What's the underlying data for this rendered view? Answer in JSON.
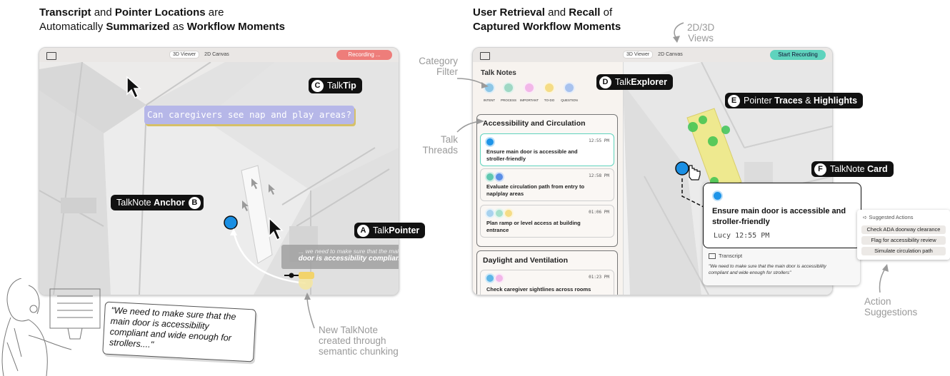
{
  "left_heading": {
    "p1": "Transcript",
    "p2": " and ",
    "p3": "Pointer Locations",
    "p4": " are",
    "p5": "Automatically ",
    "p6": "Summarized",
    "p7": " as ",
    "p8": "Workflow Moments"
  },
  "right_heading": {
    "p1": "User Retrieval",
    "p2": " and ",
    "p3": "Recall",
    "p4": " of",
    "p5": "Captured Workflow Moments"
  },
  "left_app": {
    "tab_3d": "3D Viewer",
    "tab_2d": "2D Canvas",
    "record_label": "Recording ...",
    "talktip_text": "Can caregivers see nap and play areas?",
    "transcript_line1": "... we need to make sure that the main",
    "transcript_line2": "door is accessibility compliant"
  },
  "labels": {
    "A": {
      "letter": "A",
      "pre": "Talk",
      "bold": "Pointer"
    },
    "B": {
      "letter": "B",
      "pre": "TalkNote ",
      "bold": "Anchor"
    },
    "C": {
      "letter": "C",
      "pre": "Talk",
      "bold": "Tip"
    },
    "D": {
      "letter": "D",
      "pre": "Talk",
      "bold": "Explorer"
    },
    "E": {
      "letter": "E",
      "pre": "Pointer ",
      "bold": "Traces",
      "mid": " & ",
      "bold2": "Highlights"
    },
    "F": {
      "letter": "F",
      "pre": "TalkNote ",
      "bold": "Card"
    }
  },
  "speech_bubble": "\"We need to make sure that the main door is accessibility compliant and wide enough for strollers....\"",
  "annotations": {
    "new_talknote": [
      "New TalkNote",
      "created through",
      "semantic chunking"
    ],
    "views_2d3d": [
      "2D/3D",
      "Views"
    ],
    "category_filter": [
      "Category",
      "Filter"
    ],
    "talk_threads": [
      "Talk",
      "Threads"
    ],
    "action_suggestions": [
      "Action",
      "Suggestions"
    ]
  },
  "right_app": {
    "tab_3d": "3D Viewer",
    "tab_2d": "2D Canvas",
    "record_label": "Start Recording",
    "panel_title": "Talk Notes",
    "categories": [
      {
        "label": "INTENT",
        "color": "#8ec7e6"
      },
      {
        "label": "PROCESS",
        "color": "#9fd8c4"
      },
      {
        "label": "IMPORTANT",
        "color": "#f2b7e8"
      },
      {
        "label": "TO-DO",
        "color": "#f5dc86"
      },
      {
        "label": "QUESTION",
        "color": "#a8c2ee"
      }
    ],
    "thread1": {
      "title": "Accessibility and Circulation",
      "notes": [
        {
          "time": "12:55 PM",
          "line1": "Ensure main door is accessible and",
          "line2": "stroller-friendly"
        },
        {
          "time": "12:58 PM",
          "line1": "Evaluate circulation path from entry to",
          "line2": "nap/play areas"
        },
        {
          "time": "01:06 PM",
          "line1": "Plan ramp or level access at building",
          "line2": "entrance"
        }
      ]
    },
    "thread2": {
      "title": "Daylight and Ventilation",
      "notes": [
        {
          "time": "01:23 PM",
          "line1": "Check caregiver sightlines across rooms"
        }
      ]
    },
    "card": {
      "line1": "Ensure main door is accessible and",
      "line2": "stroller-friendly",
      "author_time": "Lucy 12:55 PM",
      "transcript_label": "Transcript",
      "transcript_line1": "\"We need to make sure that the main door is accessibility",
      "transcript_line2": "compliant and wide enough for strollers\""
    },
    "suggested": {
      "title": "Suggested Actions",
      "actions": [
        "Check ADA doorway clearance",
        "Flag for accessibility review",
        "Simulate circulation path"
      ]
    }
  }
}
